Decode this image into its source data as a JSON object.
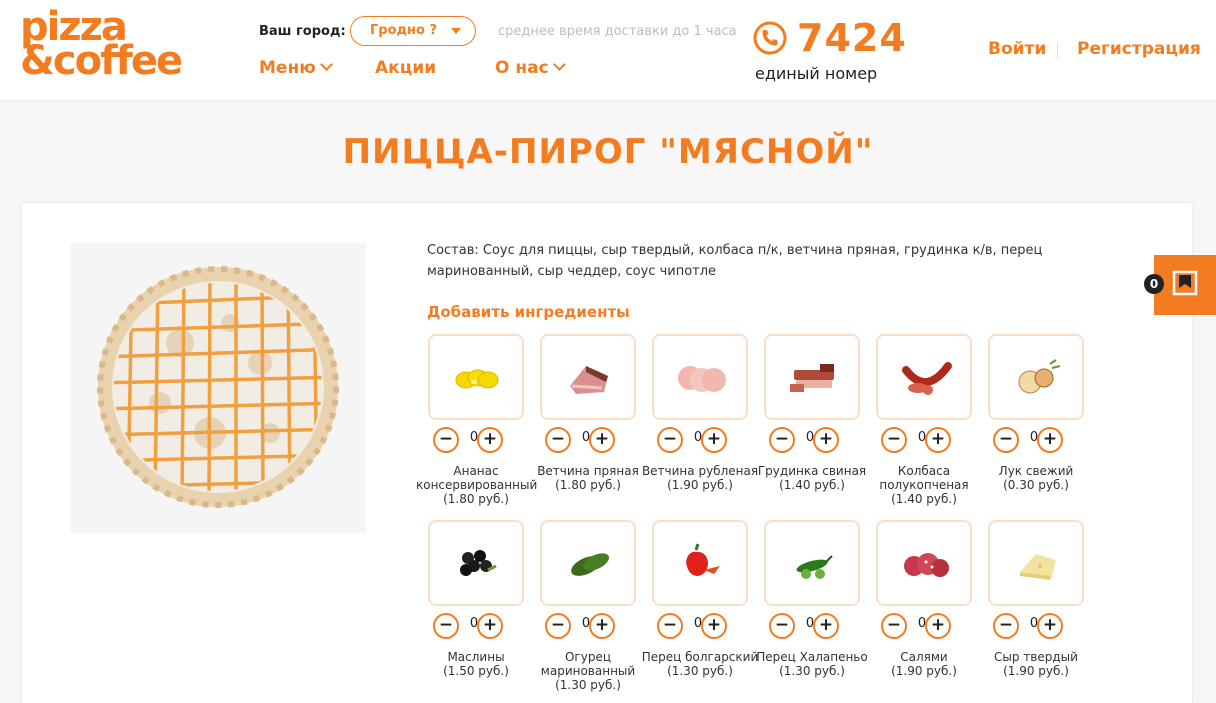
{
  "header": {
    "logo_line1": "pizza",
    "logo_line2": "&coffee",
    "city_label": "Ваш город:",
    "city_value": "Гродно ?",
    "delivery_note": "среднее время доставки до 1 часа",
    "nav": [
      {
        "label": "Меню",
        "has_dropdown": true
      },
      {
        "label": "Акции",
        "has_dropdown": false
      },
      {
        "label": "О нас",
        "has_dropdown": true
      }
    ],
    "phone_icon": "phone-icon",
    "phone_number": "7424",
    "phone_caption": "единый номер",
    "login": "Войти",
    "register": "Регистрация"
  },
  "page_title": "ПИЦЦА-ПИРОГ \"МЯСНОЙ\"",
  "product": {
    "composition": "Состав: Соус для пиццы, сыр твердый, колбаса п/к, ветчина пряная, грудинка к/в, перец маринованный, сыр чеддер, соус чипотле",
    "add_title": "Добавить ингредиенты"
  },
  "ingredients": [
    {
      "name": "Ананас консервированный",
      "price": "(1.80 руб.)",
      "qty": "0",
      "icon": "pineapple-icon"
    },
    {
      "name": "Ветчина пряная",
      "price": "(1.80 руб.)",
      "qty": "0",
      "icon": "ham-icon"
    },
    {
      "name": "Ветчина рубленая",
      "price": "(1.90 руб.)",
      "qty": "0",
      "icon": "ham-slices-icon"
    },
    {
      "name": "Грудинка свиная",
      "price": "(1.40 руб.)",
      "qty": "0",
      "icon": "bacon-icon"
    },
    {
      "name": "Колбаса полукопченая",
      "price": "(1.40 руб.)",
      "qty": "0",
      "icon": "sausage-icon"
    },
    {
      "name": "Лук свежий",
      "price": "(0.30 руб.)",
      "qty": "0",
      "icon": "onion-icon"
    },
    {
      "name": "Маслины",
      "price": "(1.50 руб.)",
      "qty": "0",
      "icon": "olives-icon"
    },
    {
      "name": "Огурец маринованный",
      "price": "(1.30 руб.)",
      "qty": "0",
      "icon": "cucumber-icon"
    },
    {
      "name": "Перец болгарский",
      "price": "(1.30 руб.)",
      "qty": "0",
      "icon": "bell-pepper-icon"
    },
    {
      "name": "Перец Халапеньо",
      "price": "(1.30 руб.)",
      "qty": "0",
      "icon": "jalapeno-icon"
    },
    {
      "name": "Салями",
      "price": "(1.90 руб.)",
      "qty": "0",
      "icon": "salami-icon"
    },
    {
      "name": "Сыр твердый",
      "price": "(1.90 руб.)",
      "qty": "0",
      "icon": "cheese-icon"
    }
  ],
  "controls": {
    "minus": "−",
    "plus": "+"
  },
  "cart": {
    "count": "0",
    "icon": "bookmark-icon"
  },
  "colors": {
    "accent": "#f47c20",
    "tile_border": "#fadfc8"
  }
}
